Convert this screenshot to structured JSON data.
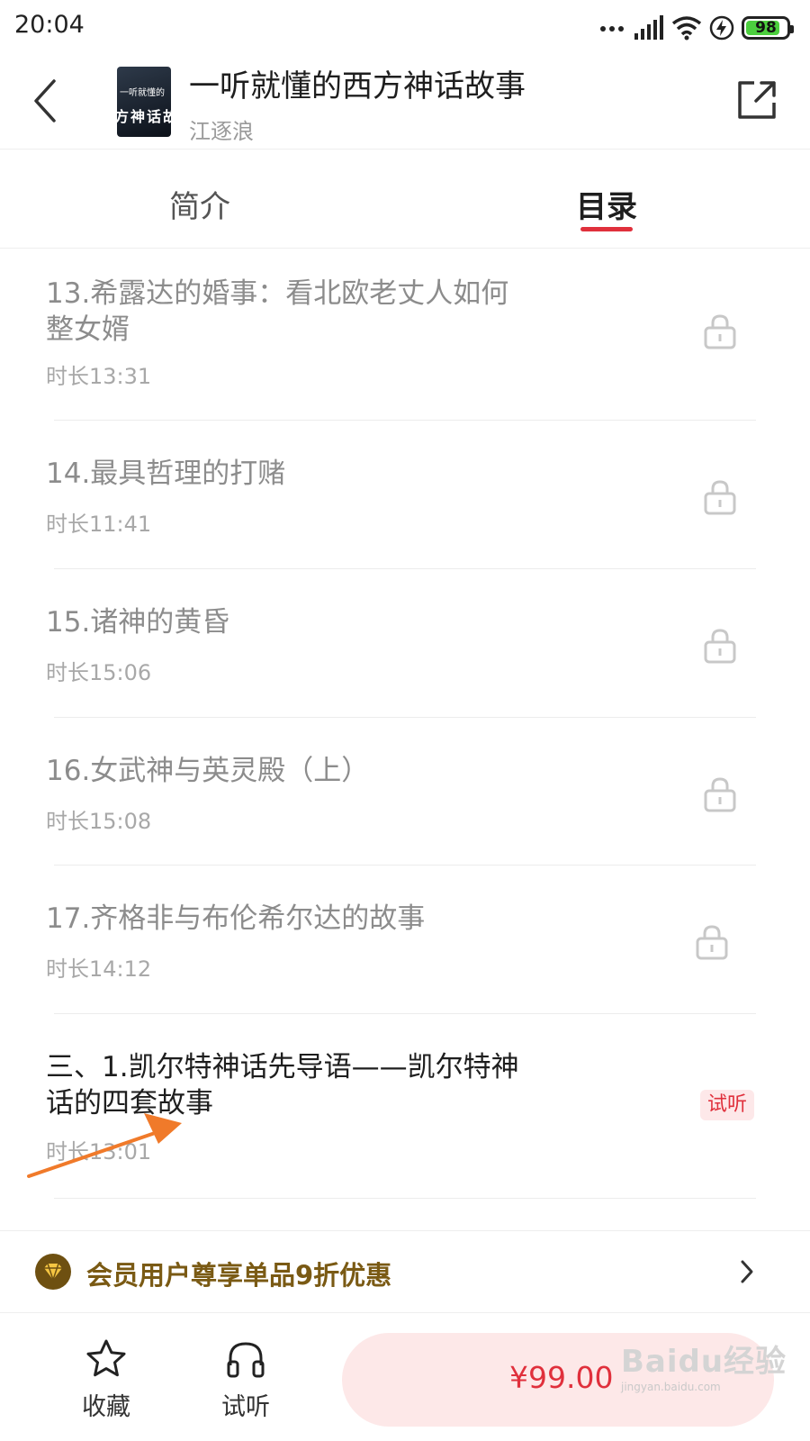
{
  "status_bar": {
    "time": "20:04",
    "battery": "98",
    "icons": [
      "signal-dots-icon",
      "cellular-signal-icon",
      "wifi-icon",
      "charging-icon",
      "battery-icon"
    ]
  },
  "header": {
    "title": "一听就懂的西方神话故事",
    "author": "江逐浪",
    "cover_text_line1": "一听就懂的",
    "cover_text_line2": "方神话故",
    "back_icon": "chevron-left-icon",
    "share_icon": "share-icon"
  },
  "tabs": [
    {
      "label": "简介",
      "active": false
    },
    {
      "label": "目录",
      "active": true
    }
  ],
  "catalog": {
    "items": [
      {
        "title": "13.希露达的婚事：看北欧老丈人如何整女婿",
        "duration": "时长13:31",
        "locked": true
      },
      {
        "title": "14.最具哲理的打赌",
        "duration": "时长11:41",
        "locked": true
      },
      {
        "title": "15.诸神的黄昏",
        "duration": "时长15:06",
        "locked": true
      },
      {
        "title": "16.女武神与英灵殿（上）",
        "duration": "时长15:08",
        "locked": true
      },
      {
        "title": "17.齐格非与布伦希尔达的故事",
        "duration": "时长14:12",
        "locked": true
      },
      {
        "title": "三、1.凯尔特神话先导语——凯尔特神话的四套故事",
        "duration": "时长13:01",
        "locked": false,
        "badge": "试听"
      }
    ]
  },
  "vip_banner": {
    "text": "会员用户尊享单品9折优惠",
    "accent": "#7a5a14"
  },
  "bottom_bar": {
    "favorite_label": "收藏",
    "preview_label": "试听",
    "price": "¥99.00"
  },
  "watermark": {
    "main": "Baidu经验",
    "sub": "jingyan.baidu.com"
  },
  "colors": {
    "brand_red": "#e0303c",
    "badge_bg": "#fde8e9",
    "annotation_arrow": "#f07a2a"
  }
}
